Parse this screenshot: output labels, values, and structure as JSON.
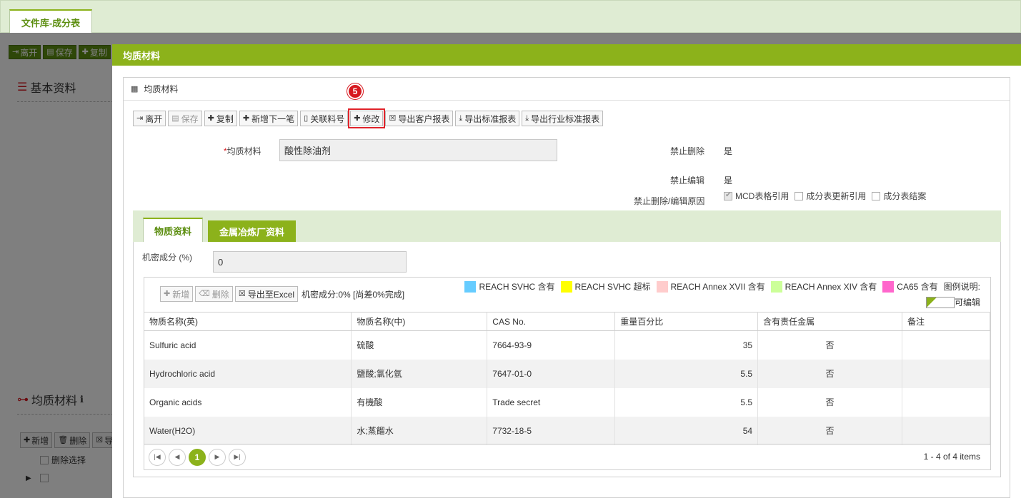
{
  "top": {
    "tab_label": "文件库-成分表"
  },
  "background": {
    "toolbar": [
      "离开",
      "保存",
      "复制"
    ],
    "section_basic": "基本资料",
    "section_material": "均质材料",
    "grid_buttons": [
      "新增",
      "删除",
      "导"
    ],
    "delete_select": "删除选择"
  },
  "modal": {
    "title": "均质材料",
    "panel_title": "均质材料",
    "step_badge": "5",
    "toolbar": {
      "leave": "离开",
      "save": "保存",
      "copy": "复制",
      "add_next": "新增下一笔",
      "link_part": "关联料号",
      "edit": "修改",
      "export_customer": "导出客户报表",
      "export_standard": "导出标准报表",
      "export_industry": "导出行业标准报表"
    },
    "form": {
      "material_label": "均质材料",
      "material_value": "酸性除油剂",
      "forbid_delete_label": "禁止删除",
      "forbid_delete_value": "是",
      "forbid_edit_label": "禁止编辑",
      "forbid_edit_value": "是",
      "reason_label": "禁止删除/编辑原因",
      "reason_options": [
        {
          "label": "MCD表格引用",
          "checked": true
        },
        {
          "label": "成分表更新引用",
          "checked": false
        },
        {
          "label": "成分表结案",
          "checked": false
        }
      ]
    },
    "tabs": {
      "active": "物质资料",
      "inactive": "金属冶炼厂资料"
    },
    "substance": {
      "confidential_label": "机密成分 (%)",
      "confidential_value": "0",
      "grid_toolbar": {
        "add": "新增",
        "delete": "删除",
        "export": "导出至Excel"
      },
      "status": "机密成分:0% [尚差0%完成]",
      "legend": [
        {
          "label": "REACH SVHC 含有",
          "color": "#66ccff"
        },
        {
          "label": "REACH SVHC 超标",
          "color": "#ffff00"
        },
        {
          "label": "REACH Annex XVII 含有",
          "color": "#ffcccc"
        },
        {
          "label": "REACH Annex XIV 含有",
          "color": "#ccff99"
        },
        {
          "label": "CA65 含有",
          "color": "#ff66cc"
        }
      ],
      "legend_title": "图例说明:",
      "editable_label": "可编辑",
      "columns": [
        "物质名称(英)",
        "物质名称(中)",
        "CAS No.",
        "重量百分比",
        "含有责任金属",
        "备注"
      ],
      "rows": [
        [
          "Sulfuric acid",
          "硫酸",
          "7664-93-9",
          "35",
          "否",
          ""
        ],
        [
          "Hydrochloric acid",
          "鹽酸;氯化氫",
          "7647-01-0",
          "5.5",
          "否",
          ""
        ],
        [
          "Organic acids",
          "有機酸",
          "Trade secret",
          "5.5",
          "否",
          ""
        ],
        [
          "Water(H2O)",
          "水;蒸餾水",
          "7732-18-5",
          "54",
          "否",
          ""
        ]
      ],
      "pager": {
        "current": "1",
        "info": "1 - 4 of 4 items"
      }
    }
  }
}
